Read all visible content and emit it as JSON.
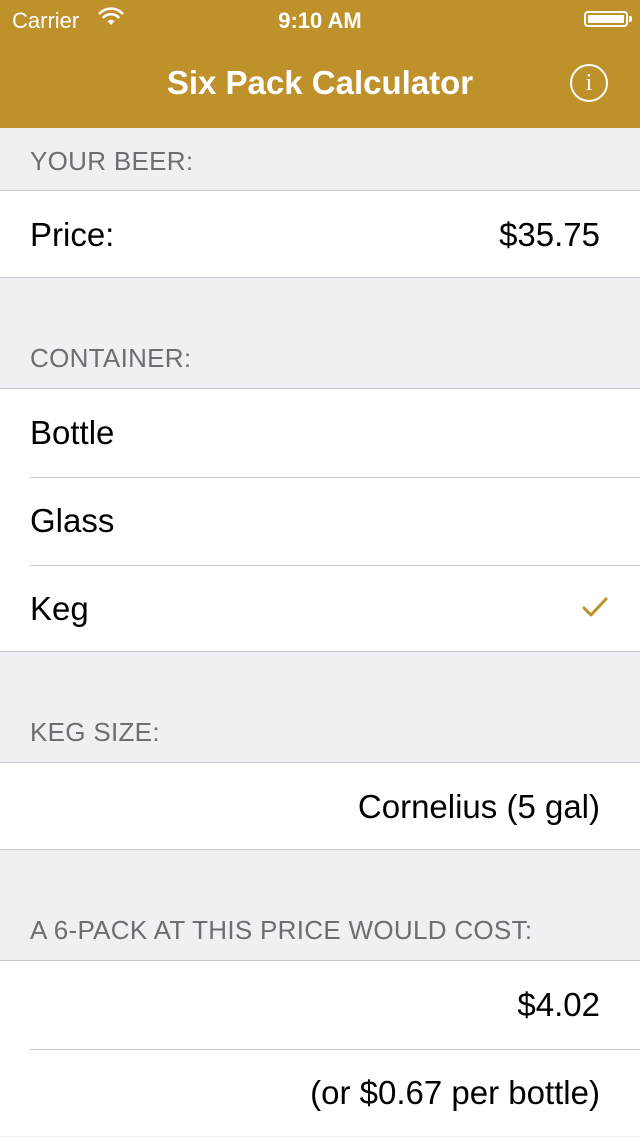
{
  "status_bar": {
    "carrier": "Carrier",
    "time": "9:10 AM"
  },
  "nav": {
    "title": "Six Pack Calculator",
    "info_icon_glyph": "i"
  },
  "sections": {
    "your_beer": {
      "header": "YOUR BEER:",
      "price_label": "Price:",
      "price_value": "$35.75"
    },
    "container": {
      "header": "CONTAINER:",
      "options": [
        "Bottle",
        "Glass",
        "Keg"
      ],
      "selected": "Keg"
    },
    "keg_size": {
      "header": "KEG SIZE:",
      "value": "Cornelius (5 gal)"
    },
    "result": {
      "header": "A 6-PACK AT THIS PRICE WOULD COST:",
      "six_pack_cost": "$4.02",
      "per_bottle": "(or $0.67 per bottle)"
    }
  },
  "colors": {
    "accent": "#bf912b",
    "background": "#efeff4",
    "header_text": "#6d6d72",
    "separator": "#c8c7cc"
  }
}
